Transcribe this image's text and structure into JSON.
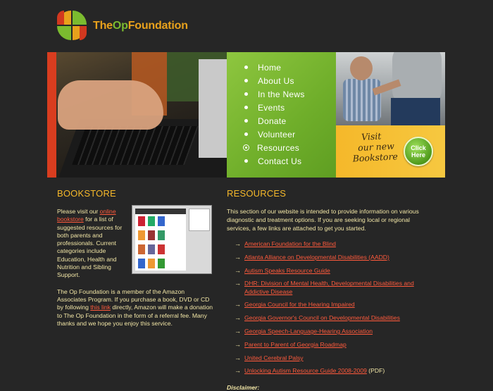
{
  "logo": {
    "the": "The",
    "op": "Op",
    "foundation": "Foundation"
  },
  "nav": {
    "items": [
      {
        "label": "Home"
      },
      {
        "label": "About Us"
      },
      {
        "label": "In the News"
      },
      {
        "label": "Events"
      },
      {
        "label": "Donate"
      },
      {
        "label": "Volunteer"
      },
      {
        "label": "Resources"
      },
      {
        "label": "Contact Us"
      }
    ]
  },
  "promo": {
    "line1": "Visit",
    "line2": "our new",
    "line3": "Bookstore",
    "button": "Click Here"
  },
  "bookstore": {
    "heading": "BOOKSTORE",
    "intro_pre": "Please visit our ",
    "intro_link": "online bookstore",
    "intro_post": " for a list of suggested resources for both parents and professionals. Current categories include Education, Health and Nutrition and Sibling Support.",
    "member_pre": "The Op Foundation is a member of the Amazon Associates Program. If you purchase a book, DVD or CD by following ",
    "member_link": "this link",
    "member_post": " directly, Amazon will make a donation to The Op Foundation in the form of a referral fee. Many thanks and we hope you enjoy this service."
  },
  "resources": {
    "heading": "RESOURCES",
    "intro": "This section of our website is intended to provide information on various diagnostic and treatment options. If you are seeking local or regional services, a few links are attached to get you started.",
    "links": [
      {
        "label": "American Foundation for the Blind",
        "suffix": ""
      },
      {
        "label": "Atlanta Alliance on Developmental Disabilities (AADD)",
        "suffix": ""
      },
      {
        "label": "Autism Speaks Resource Guide",
        "suffix": ""
      },
      {
        "label": "DHR: Division of Mental Health, Developmental Disabilities and Addictive Disease",
        "suffix": ""
      },
      {
        "label": "Georgia Council for the Hearing Impaired",
        "suffix": ""
      },
      {
        "label": "Georgia Governor's Council on Developmental Disabilities",
        "suffix": ""
      },
      {
        "label": "Georgia Speech-Language-Hearing Association",
        "suffix": ""
      },
      {
        "label": "Parent to Parent of Georgia Roadmap",
        "suffix": ""
      },
      {
        "label": "United Cerebral Palsy",
        "suffix": ""
      },
      {
        "label": "Unlocking Autism Resource Guide 2008-2009",
        "suffix": " (PDF)"
      }
    ],
    "disclaimer": "Disclaimer:"
  },
  "colors": {
    "background": "#262626",
    "accent_orange": "#f5b82a",
    "accent_green": "#7bbb2f",
    "link": "#ff5a3c",
    "text": "#f2e6a6"
  }
}
